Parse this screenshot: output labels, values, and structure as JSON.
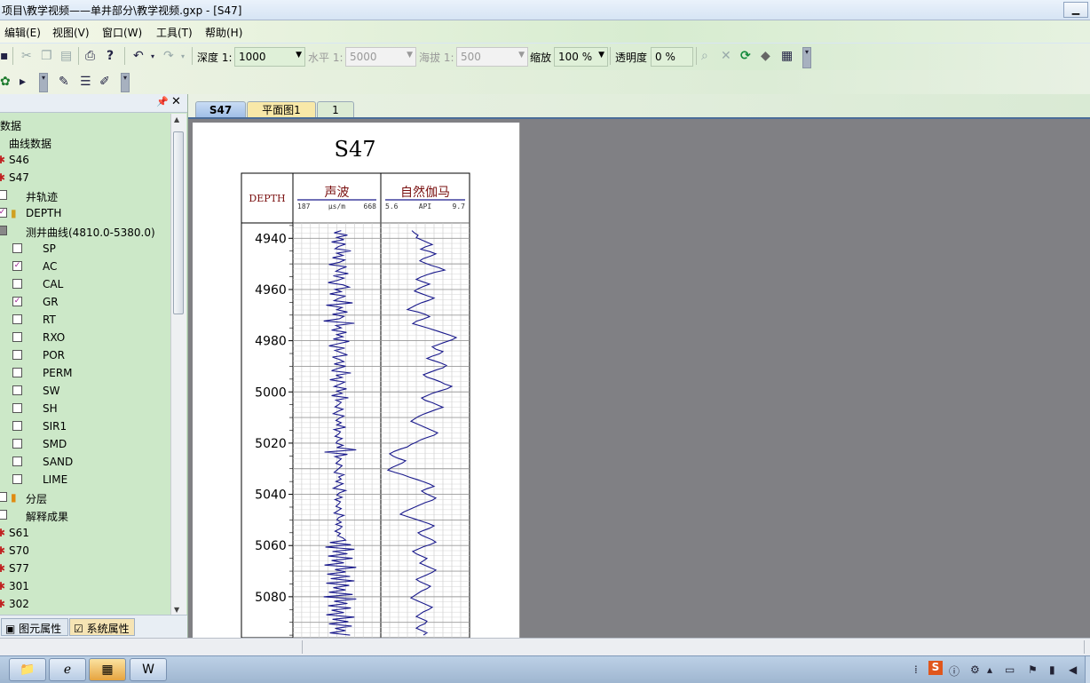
{
  "window": {
    "title": "项目\\教学视频——单井部分\\教学视频.gxp - [S47]"
  },
  "menu": [
    "编辑(E)",
    "视图(V)",
    "窗口(W)",
    "工具(T)",
    "帮助(H)"
  ],
  "toolbar": {
    "depth_label": "深度 1:",
    "depth_value": "1000",
    "horizontal_label": "水平 1:",
    "horizontal_value": "5000",
    "elevation_label": "海拔 1:",
    "elevation_value": "500",
    "zoom_label": "缩放",
    "zoom_value": "100 %",
    "transparency_label": "透明度",
    "transparency_value": "0 %"
  },
  "tree": [
    {
      "label": "数据",
      "indent": 0,
      "icon": "",
      "check": null
    },
    {
      "label": "曲线数据",
      "indent": 10,
      "icon": "",
      "check": null
    },
    {
      "label": "S46",
      "indent": 10,
      "icon": "well",
      "check": null
    },
    {
      "label": "S47",
      "indent": 10,
      "icon": "well",
      "check": null
    },
    {
      "label": "井轨迹",
      "indent": 29,
      "icon": "",
      "check": "empty"
    },
    {
      "label": "DEPTH",
      "indent": 29,
      "icon": "ruler",
      "check": "checked"
    },
    {
      "label": "测井曲线(4810.0-5380.0)",
      "indent": 29,
      "icon": "",
      "check": "partial"
    },
    {
      "label": "SP",
      "indent": 48,
      "icon": "",
      "check": "empty"
    },
    {
      "label": "AC",
      "indent": 48,
      "icon": "",
      "check": "checked"
    },
    {
      "label": "CAL",
      "indent": 48,
      "icon": "",
      "check": "empty"
    },
    {
      "label": "GR",
      "indent": 48,
      "icon": "",
      "check": "checked"
    },
    {
      "label": "RT",
      "indent": 48,
      "icon": "",
      "check": "empty"
    },
    {
      "label": "RXO",
      "indent": 48,
      "icon": "",
      "check": "empty"
    },
    {
      "label": "POR",
      "indent": 48,
      "icon": "",
      "check": "empty"
    },
    {
      "label": "PERM",
      "indent": 48,
      "icon": "",
      "check": "empty"
    },
    {
      "label": "SW",
      "indent": 48,
      "icon": "",
      "check": "empty"
    },
    {
      "label": "SH",
      "indent": 48,
      "icon": "",
      "check": "empty"
    },
    {
      "label": "SIR1",
      "indent": 48,
      "icon": "",
      "check": "empty"
    },
    {
      "label": "SMD",
      "indent": 48,
      "icon": "",
      "check": "empty"
    },
    {
      "label": "SAND",
      "indent": 48,
      "icon": "",
      "check": "empty"
    },
    {
      "label": "LIME",
      "indent": 48,
      "icon": "",
      "check": "empty"
    },
    {
      "label": "分层",
      "indent": 29,
      "icon": "layer",
      "check": "empty"
    },
    {
      "label": "解释成果",
      "indent": 29,
      "icon": "",
      "check": "empty"
    },
    {
      "label": "S61",
      "indent": 10,
      "icon": "well",
      "check": null
    },
    {
      "label": "S70",
      "indent": 10,
      "icon": "well",
      "check": null
    },
    {
      "label": "S77",
      "indent": 10,
      "icon": "well",
      "check": null
    },
    {
      "label": "301",
      "indent": 10,
      "icon": "well",
      "check": null
    },
    {
      "label": "302",
      "indent": 10,
      "icon": "well",
      "check": null
    }
  ],
  "panel_tabs": [
    "图元属性",
    "系统属性"
  ],
  "doc_tabs": [
    "S47",
    "平面图1",
    "1"
  ],
  "chart_data": {
    "type": "line",
    "title": "S47",
    "depth_header": "DEPTH",
    "depth_ticks": [
      4940,
      4960,
      4980,
      5000,
      5020,
      5040,
      5060,
      5080
    ],
    "depth_range": [
      4934,
      5096
    ],
    "tracks": [
      {
        "name": "声波",
        "unit": "μs/m",
        "min_label": "187",
        "max_label": "668",
        "color": "#1a1a8c",
        "values": [
          0.55,
          0.47,
          0.62,
          0.5,
          0.58,
          0.44,
          0.6,
          0.52,
          0.48,
          0.66,
          0.5,
          0.57,
          0.45,
          0.59,
          0.53,
          0.41,
          0.61,
          0.54,
          0.49,
          0.63,
          0.46,
          0.58,
          0.51,
          0.4,
          0.57,
          0.64,
          0.48,
          0.55,
          0.42,
          0.6,
          0.52,
          0.47,
          0.68,
          0.38,
          0.56,
          0.5,
          0.62,
          0.45,
          0.58,
          0.53,
          0.35,
          0.7,
          0.49,
          0.55,
          0.44,
          0.61,
          0.5,
          0.57,
          0.46,
          0.64,
          0.52,
          0.41,
          0.59,
          0.48,
          0.55,
          0.62,
          0.45,
          0.53,
          0.58,
          0.47,
          0.6,
          0.51,
          0.44,
          0.66,
          0.49,
          0.56,
          0.42,
          0.59,
          0.53,
          0.47,
          0.61,
          0.5,
          0.56,
          0.44,
          0.63,
          0.49,
          0.55,
          0.52,
          0.48,
          0.57,
          0.51,
          0.46,
          0.58,
          0.53,
          0.49,
          0.55,
          0.5,
          0.6,
          0.47,
          0.54,
          0.52,
          0.48,
          0.56,
          0.51,
          0.49,
          0.57,
          0.5,
          0.72,
          0.36,
          0.62,
          0.48,
          0.55,
          0.52,
          0.49,
          0.56,
          0.53,
          0.5,
          0.47,
          0.58,
          0.52,
          0.55,
          0.49,
          0.57,
          0.51,
          0.46,
          0.6,
          0.53,
          0.5,
          0.56,
          0.48,
          0.54,
          0.52,
          0.49,
          0.55,
          0.51,
          0.47,
          0.58,
          0.52,
          0.5,
          0.55,
          0.49,
          0.56,
          0.53,
          0.48,
          0.54,
          0.51,
          0.57,
          0.6,
          0.42,
          0.66,
          0.37,
          0.7,
          0.45,
          0.62,
          0.4,
          0.68,
          0.44,
          0.58,
          0.36,
          0.72,
          0.48,
          0.6,
          0.39,
          0.65,
          0.43,
          0.7,
          0.38,
          0.64,
          0.46,
          0.6,
          0.41,
          0.68,
          0.35,
          0.72,
          0.47,
          0.62,
          0.4,
          0.66,
          0.44,
          0.58,
          0.38,
          0.7,
          0.45,
          0.63,
          0.41,
          0.67,
          0.48,
          0.6,
          0.42,
          0.65
        ]
      },
      {
        "name": "自然伽马",
        "unit": "API",
        "min_label": "5.6",
        "max_label": "9.7",
        "color": "#1a1a8c",
        "values": [
          0.35,
          0.38,
          0.42,
          0.4,
          0.46,
          0.52,
          0.58,
          0.5,
          0.45,
          0.55,
          0.62,
          0.56,
          0.48,
          0.44,
          0.5,
          0.57,
          0.66,
          0.72,
          0.6,
          0.52,
          0.45,
          0.4,
          0.47,
          0.55,
          0.48,
          0.42,
          0.38,
          0.45,
          0.52,
          0.6,
          0.54,
          0.46,
          0.4,
          0.35,
          0.3,
          0.42,
          0.5,
          0.55,
          0.48,
          0.4,
          0.36,
          0.45,
          0.54,
          0.62,
          0.7,
          0.78,
          0.85,
          0.8,
          0.72,
          0.65,
          0.58,
          0.62,
          0.7,
          0.66,
          0.58,
          0.52,
          0.6,
          0.68,
          0.74,
          0.7,
          0.62,
          0.55,
          0.48,
          0.52,
          0.6,
          0.67,
          0.72,
          0.8,
          0.75,
          0.66,
          0.58,
          0.52,
          0.46,
          0.5,
          0.58,
          0.64,
          0.7,
          0.62,
          0.55,
          0.48,
          0.42,
          0.38,
          0.34,
          0.4,
          0.46,
          0.52,
          0.58,
          0.64,
          0.6,
          0.52,
          0.45,
          0.4,
          0.34,
          0.3,
          0.22,
          0.15,
          0.1,
          0.14,
          0.2,
          0.28,
          0.24,
          0.18,
          0.12,
          0.08,
          0.16,
          0.25,
          0.32,
          0.4,
          0.48,
          0.55,
          0.6,
          0.52,
          0.46,
          0.5,
          0.56,
          0.62,
          0.58,
          0.5,
          0.44,
          0.38,
          0.32,
          0.26,
          0.22,
          0.3,
          0.38,
          0.46,
          0.54,
          0.6,
          0.55,
          0.48,
          0.42,
          0.46,
          0.52,
          0.58,
          0.62,
          0.56,
          0.48,
          0.42,
          0.36,
          0.4,
          0.46,
          0.52,
          0.48,
          0.44,
          0.5,
          0.56,
          0.62,
          0.58,
          0.52,
          0.46,
          0.4,
          0.44,
          0.5,
          0.56,
          0.52,
          0.46,
          0.42,
          0.38,
          0.34,
          0.4,
          0.46,
          0.52,
          0.58,
          0.54,
          0.48,
          0.44,
          0.4,
          0.46,
          0.52,
          0.5,
          0.44,
          0.4,
          0.46,
          0.52,
          0.48
        ]
      }
    ]
  }
}
